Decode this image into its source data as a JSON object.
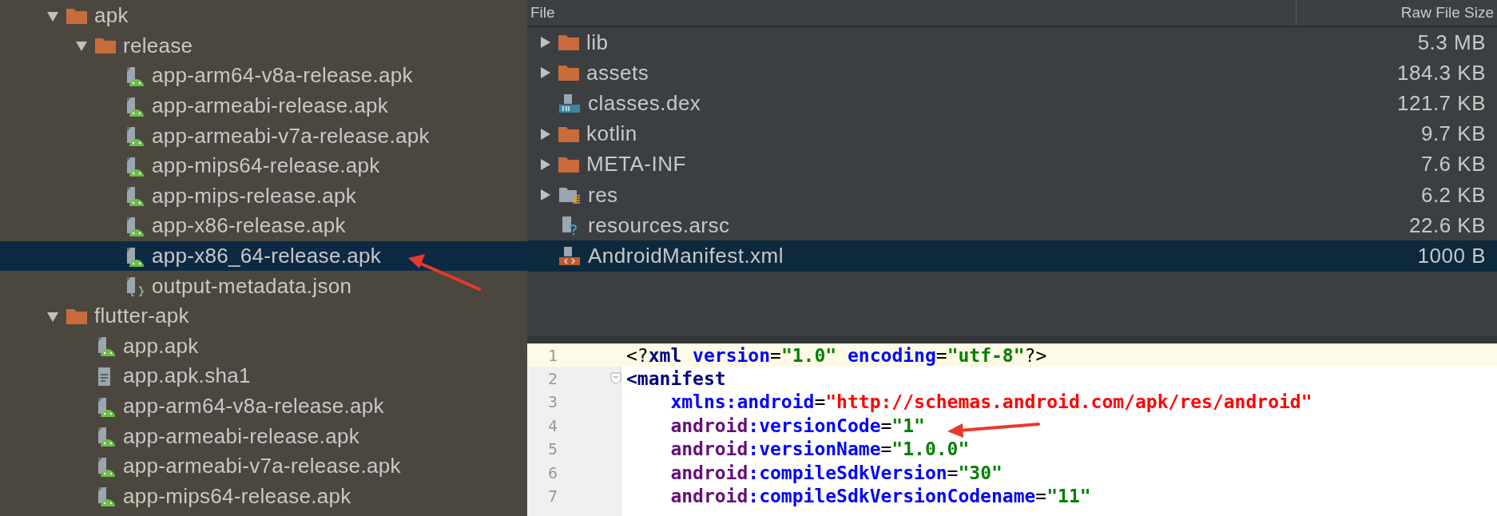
{
  "project_tree": {
    "items": [
      {
        "label": "apk",
        "kind": "folder",
        "expanded": true,
        "selected": false,
        "children": [
          {
            "label": "release",
            "kind": "folder",
            "expanded": true,
            "selected": false,
            "children": [
              {
                "label": "app-arm64-v8a-release.apk",
                "kind": "apk",
                "selected": false
              },
              {
                "label": "app-armeabi-release.apk",
                "kind": "apk",
                "selected": false
              },
              {
                "label": "app-armeabi-v7a-release.apk",
                "kind": "apk",
                "selected": false
              },
              {
                "label": "app-mips64-release.apk",
                "kind": "apk",
                "selected": false
              },
              {
                "label": "app-mips-release.apk",
                "kind": "apk",
                "selected": false
              },
              {
                "label": "app-x86-release.apk",
                "kind": "apk",
                "selected": false
              },
              {
                "label": "app-x86_64-release.apk",
                "kind": "apk",
                "selected": true
              },
              {
                "label": "output-metadata.json",
                "kind": "json",
                "selected": false
              }
            ]
          }
        ]
      },
      {
        "label": "flutter-apk",
        "kind": "folder",
        "expanded": true,
        "selected": false,
        "children": [
          {
            "label": "app.apk",
            "kind": "apk",
            "selected": false
          },
          {
            "label": "app.apk.sha1",
            "kind": "text",
            "selected": false
          },
          {
            "label": "app-arm64-v8a-release.apk",
            "kind": "apk",
            "selected": false
          },
          {
            "label": "app-armeabi-release.apk",
            "kind": "apk",
            "selected": false
          },
          {
            "label": "app-armeabi-v7a-release.apk",
            "kind": "apk",
            "selected": false
          },
          {
            "label": "app-mips64-release.apk",
            "kind": "apk",
            "selected": false
          }
        ]
      }
    ]
  },
  "apk_contents": {
    "columns": [
      "File",
      "Raw File Size"
    ],
    "rows": [
      {
        "name": "lib",
        "kind": "folder",
        "expanded": false,
        "size": "5.3 MB",
        "selected": false
      },
      {
        "name": "assets",
        "kind": "folder",
        "expanded": false,
        "size": "184.3 KB",
        "selected": false
      },
      {
        "name": "classes.dex",
        "kind": "dex",
        "size": "121.7 KB",
        "selected": false
      },
      {
        "name": "kotlin",
        "kind": "folder",
        "expanded": false,
        "size": "9.7 KB",
        "selected": false
      },
      {
        "name": "META-INF",
        "kind": "folder",
        "expanded": false,
        "size": "7.6 KB",
        "selected": false
      },
      {
        "name": "res",
        "kind": "res",
        "expanded": false,
        "size": "6.2 KB",
        "selected": false
      },
      {
        "name": "resources.arsc",
        "kind": "arsc",
        "size": "22.6 KB",
        "selected": false
      },
      {
        "name": "AndroidManifest.xml",
        "kind": "xml",
        "size": "1000 B",
        "selected": true
      }
    ]
  },
  "editor": {
    "lines": [
      {
        "number": "1",
        "highlighted": true,
        "foldable": false,
        "tokens": [
          {
            "text": "<?",
            "kind": "plain"
          },
          {
            "text": "xml",
            "kind": "tag"
          },
          {
            "text": " version",
            "kind": "attr"
          },
          {
            "text": "=",
            "kind": "plain"
          },
          {
            "text": "\"1.0\"",
            "kind": "value"
          },
          {
            "text": " encoding",
            "kind": "attr"
          },
          {
            "text": "=",
            "kind": "plain"
          },
          {
            "text": "\"utf-8\"",
            "kind": "value"
          },
          {
            "text": "?>",
            "kind": "plain"
          }
        ]
      },
      {
        "number": "2",
        "highlighted": false,
        "foldable": true,
        "tokens": [
          {
            "text": "<manifest",
            "kind": "tag"
          }
        ]
      },
      {
        "number": "3",
        "highlighted": false,
        "foldable": false,
        "tokens": [
          {
            "text": "    xmlns:android",
            "kind": "attr"
          },
          {
            "text": "=",
            "kind": "plain"
          },
          {
            "text": "\"http://schemas.android.com/apk/res/android\"",
            "kind": "url"
          }
        ]
      },
      {
        "number": "4",
        "highlighted": false,
        "foldable": false,
        "tokens": [
          {
            "text": "    android",
            "kind": "ns"
          },
          {
            "text": ":versionCode",
            "kind": "attr"
          },
          {
            "text": "=",
            "kind": "plain"
          },
          {
            "text": "\"1\"",
            "kind": "value"
          }
        ]
      },
      {
        "number": "5",
        "highlighted": false,
        "foldable": false,
        "tokens": [
          {
            "text": "    android",
            "kind": "ns"
          },
          {
            "text": ":versionName",
            "kind": "attr"
          },
          {
            "text": "=",
            "kind": "plain"
          },
          {
            "text": "\"1.0.0\"",
            "kind": "value"
          }
        ]
      },
      {
        "number": "6",
        "highlighted": false,
        "foldable": false,
        "tokens": [
          {
            "text": "    android",
            "kind": "ns"
          },
          {
            "text": ":compileSdkVersion",
            "kind": "attr"
          },
          {
            "text": "=",
            "kind": "plain"
          },
          {
            "text": "\"30\"",
            "kind": "value"
          }
        ]
      },
      {
        "number": "7",
        "highlighted": false,
        "foldable": false,
        "tokens": [
          {
            "text": "    android",
            "kind": "ns"
          },
          {
            "text": ":compileSdkVersionCodename",
            "kind": "attr"
          },
          {
            "text": "=",
            "kind": "plain"
          },
          {
            "text": "\"11\"",
            "kind": "value"
          }
        ]
      }
    ]
  }
}
